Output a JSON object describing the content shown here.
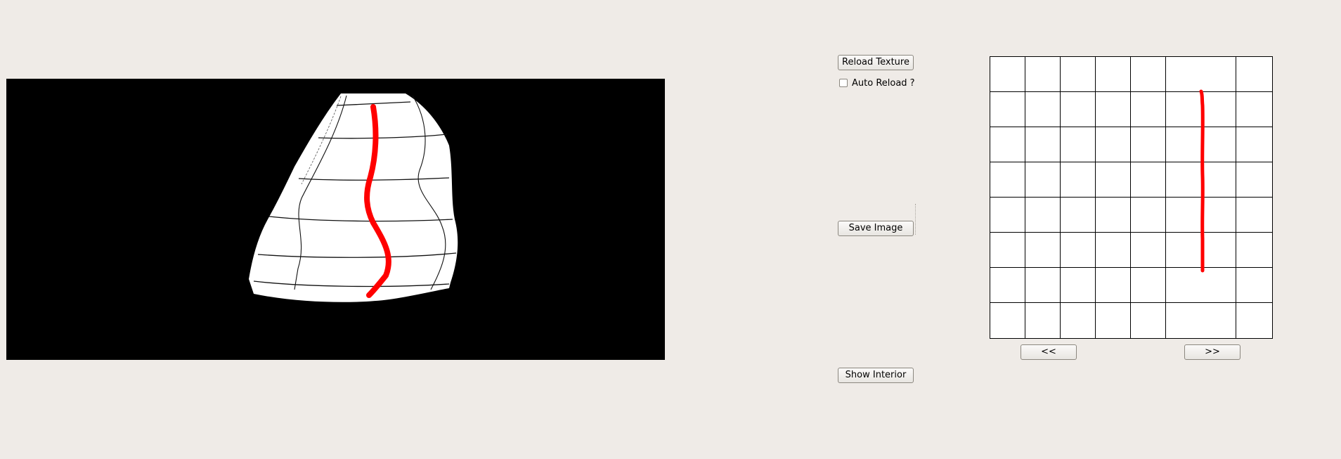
{
  "controls": {
    "reload_texture_label": "Reload Texture",
    "auto_reload_label": "Auto Reload ?",
    "auto_reload_checked": false,
    "save_image_label": "Save Image",
    "show_interior_label": "Show Interior"
  },
  "texture_nav": {
    "prev_label": "<<",
    "next_label": ">>"
  },
  "colors": {
    "background": "#efebe7",
    "viewport_background": "#000000",
    "mesh_fill": "#ffffff",
    "stroke_color": "#ff0000",
    "grid_lines": "#000000"
  }
}
